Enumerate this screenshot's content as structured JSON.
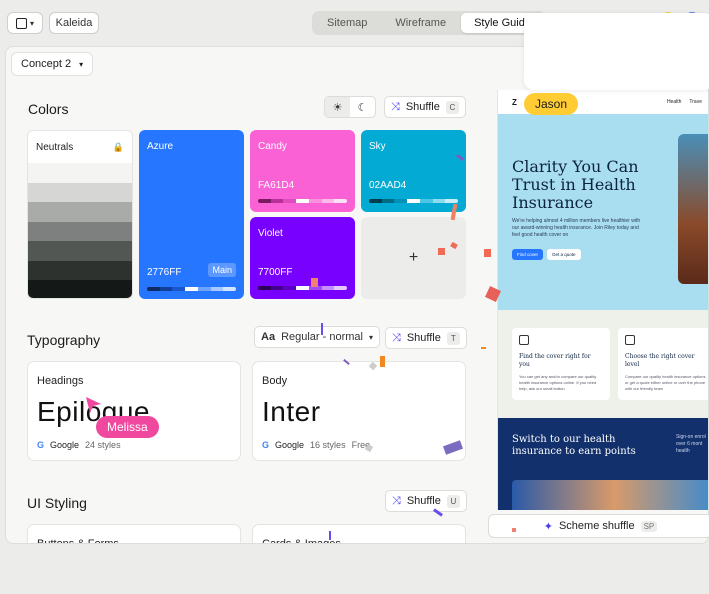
{
  "topbar": {
    "project_name": "Kaleida",
    "tabs": [
      {
        "label": "Sitemap",
        "active": false
      },
      {
        "label": "Wireframe",
        "active": false
      },
      {
        "label": "Style Guide",
        "active": true
      }
    ]
  },
  "concept": {
    "label": "Concept 2"
  },
  "colors": {
    "title": "Colors",
    "shuffle_label": "Shuffle",
    "shuffle_key": "C",
    "neutrals_label": "Neutrals",
    "swatches": [
      {
        "name": "Azure",
        "hex": "2776FF",
        "color": "#2776FF",
        "badge": "Main"
      },
      {
        "name": "Candy",
        "hex": "FA61D4",
        "color": "#FA61D4"
      },
      {
        "name": "Sky",
        "hex": "02AAD4",
        "color": "#02AAD4"
      },
      {
        "name": "Violet",
        "hex": "7700FF",
        "color": "#7700FF"
      }
    ],
    "add_label": "+"
  },
  "typography": {
    "title": "Typography",
    "font_select": "Regular - normal",
    "shuffle_label": "Shuffle",
    "shuffle_key": "T",
    "headings": {
      "label": "Headings",
      "sample": "Epilogue",
      "source": "Google",
      "styles": "24 styles"
    },
    "body": {
      "label": "Body",
      "sample": "Inter",
      "source": "Google",
      "styles": "16 styles",
      "license": "Free"
    }
  },
  "ui_styling": {
    "title": "UI Styling",
    "shuffle_label": "Shuffle",
    "shuffle_key": "U",
    "cards": [
      "Buttons & Forms",
      "Cards & Images"
    ]
  },
  "preview": {
    "nav_items": [
      "Health",
      "Trave"
    ],
    "hero_title": "Clarity You Can Trust in Health Insurance",
    "hero_body": "We're helping almost 4 million members live healthier with our award-winning health insurance. Join Riley today and feel good health cover on",
    "btn_primary": "Find cover",
    "btn_secondary": "Get a quote",
    "features": [
      {
        "title": "Find the cover right for you",
        "desc": "You can get any and/or compare our quality health insurance options online. If you need help, ask our small button"
      },
      {
        "title": "Choose the right cover level",
        "desc": "Compare our quality health insurance options or get a quote either online or over the phone with our friendly team"
      }
    ],
    "bottom_title": "Switch to our health insurance to earn points",
    "bottom_side": "Sign-on enrol over 6 mont health",
    "scheme_label": "Scheme shuffle",
    "scheme_key": "SP"
  },
  "collaborators": [
    {
      "name": "Jason",
      "color": "#FFCC33"
    },
    {
      "name": "Melissa",
      "color": "#F0489E"
    }
  ]
}
